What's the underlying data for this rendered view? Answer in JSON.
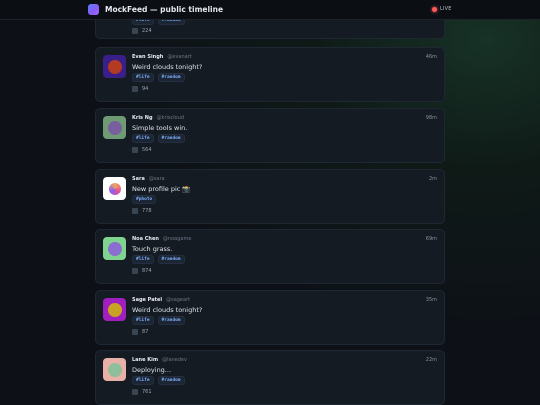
{
  "app": {
    "title": "MockFeed — public timeline",
    "live_label": "LIVE",
    "accent": "#7c6cf7"
  },
  "partial_post": {
    "tags": [
      "#life",
      "#random"
    ],
    "likes": "224"
  },
  "posts": [
    {
      "name": "Evan Singh",
      "handle": "@evanart",
      "time": "46m",
      "text": "Weird clouds tonight?",
      "tags": [
        "#life",
        "#random"
      ],
      "likes": "94",
      "avatar_bg": "#3a1f8a",
      "avatar_fg": "#b43a22",
      "avatar_icon": "avatar-icon"
    },
    {
      "name": "Kris Ng",
      "handle": "@kriscloud",
      "time": "98m",
      "text": "Simple tools win.",
      "tags": [
        "#life",
        "#random"
      ],
      "likes": "564",
      "avatar_bg": "#6f9b74",
      "avatar_fg": "#7a5f9e",
      "avatar_icon": "avatar-icon"
    },
    {
      "name": "Sara",
      "handle": "@sara",
      "time": "2m",
      "text": "New profile pic 📸",
      "tags": [
        "#photo"
      ],
      "likes": "778",
      "avatar_bg": "#ffffff",
      "avatar_fg": "#e07bb0",
      "avatar_icon": "photo-avatar-icon"
    },
    {
      "name": "Noa Chen",
      "handle": "@noagame",
      "time": "69m",
      "text": "Touch grass.",
      "tags": [
        "#life",
        "#random"
      ],
      "likes": "874",
      "avatar_bg": "#7fd48f",
      "avatar_fg": "#8a6fd0",
      "avatar_icon": "avatar-icon"
    },
    {
      "name": "Sage Patel",
      "handle": "@sageart",
      "time": "35m",
      "text": "Weird clouds tonight?",
      "tags": [
        "#life",
        "#random"
      ],
      "likes": "87",
      "avatar_bg": "#a11fbf",
      "avatar_fg": "#c9a323",
      "avatar_icon": "avatar-icon"
    },
    {
      "name": "Lane Kim",
      "handle": "@lanedev",
      "time": "22m",
      "text": "Deploying...",
      "tags": [
        "#life",
        "#random"
      ],
      "likes": "761",
      "avatar_bg": "#e9b0a8",
      "avatar_fg": "#8fbf9a",
      "avatar_icon": "avatar-icon"
    }
  ]
}
